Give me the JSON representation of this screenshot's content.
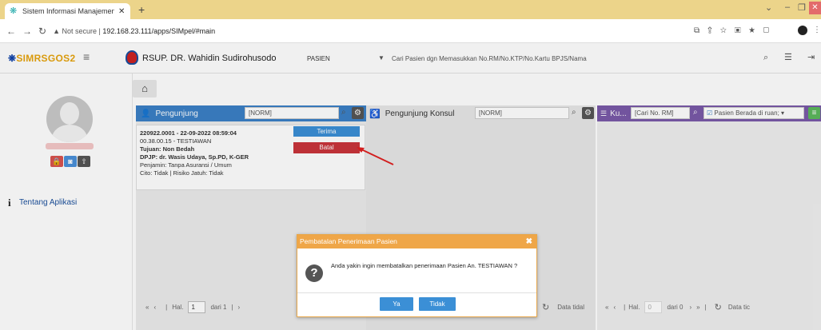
{
  "browser": {
    "tab_title": "Sistem Informasi Manajemen Pe",
    "url_security": "Not secure",
    "url": "192.168.23.111/apps/SIMpel/#main"
  },
  "header": {
    "logo_main": "SIMRS",
    "logo_accent": "GOS2",
    "hospital_name": "RSUP. DR. Wahidin Sudirohusodo",
    "category": "PASIEN",
    "search_placeholder": "Cari Pasien dgn Memasukkan No.RM/No.KTP/No.Kartu BPJS/Nama"
  },
  "sidebar": {
    "about": "Tentang Aplikasi"
  },
  "panels": {
    "pengunjung": {
      "title": "Pengunjung",
      "filter": "[NORM]"
    },
    "konsul": {
      "title": "Pengunjung Konsul",
      "filter": "[NORM]"
    },
    "kunjungan": {
      "title": "Ku...",
      "filter": "[Cari No. RM]",
      "select": "Pasien Berada di ruan;"
    }
  },
  "card": {
    "line1": "220922.0001 - 22-09-2022 08:59:04",
    "line2": "00.38.00.15 - TESTIAWAN",
    "line3": "Tujuan: Non Bedah",
    "line4": "DPJP: dr. Wasis Udaya, Sp.PD, K-GER",
    "line5": "Penjamin: Tanpa Asuransi / Umum",
    "line6": "Cito: Tidak | Risiko Jatuh: Tidak",
    "terima": "Terima",
    "batal": "Batal"
  },
  "pager1": {
    "hal": "Hal.",
    "page": "1",
    "dari": "dari 1"
  },
  "pager2": {
    "status": "Data tidal"
  },
  "pager3": {
    "hal": "Hal.",
    "page": "0",
    "dari": "dari 0",
    "status": "Data tic"
  },
  "dialog": {
    "title": "Pembatalan Penerimaan Pasien",
    "message": "Anda yakin ingin membatalkan penerimaan Pasien An. TESTIAWAN ?",
    "yes": "Ya",
    "no": "Tidak"
  },
  "colors": {
    "accent": "#3b8fd6",
    "danger": "#c9353b",
    "warning": "#efa648"
  }
}
